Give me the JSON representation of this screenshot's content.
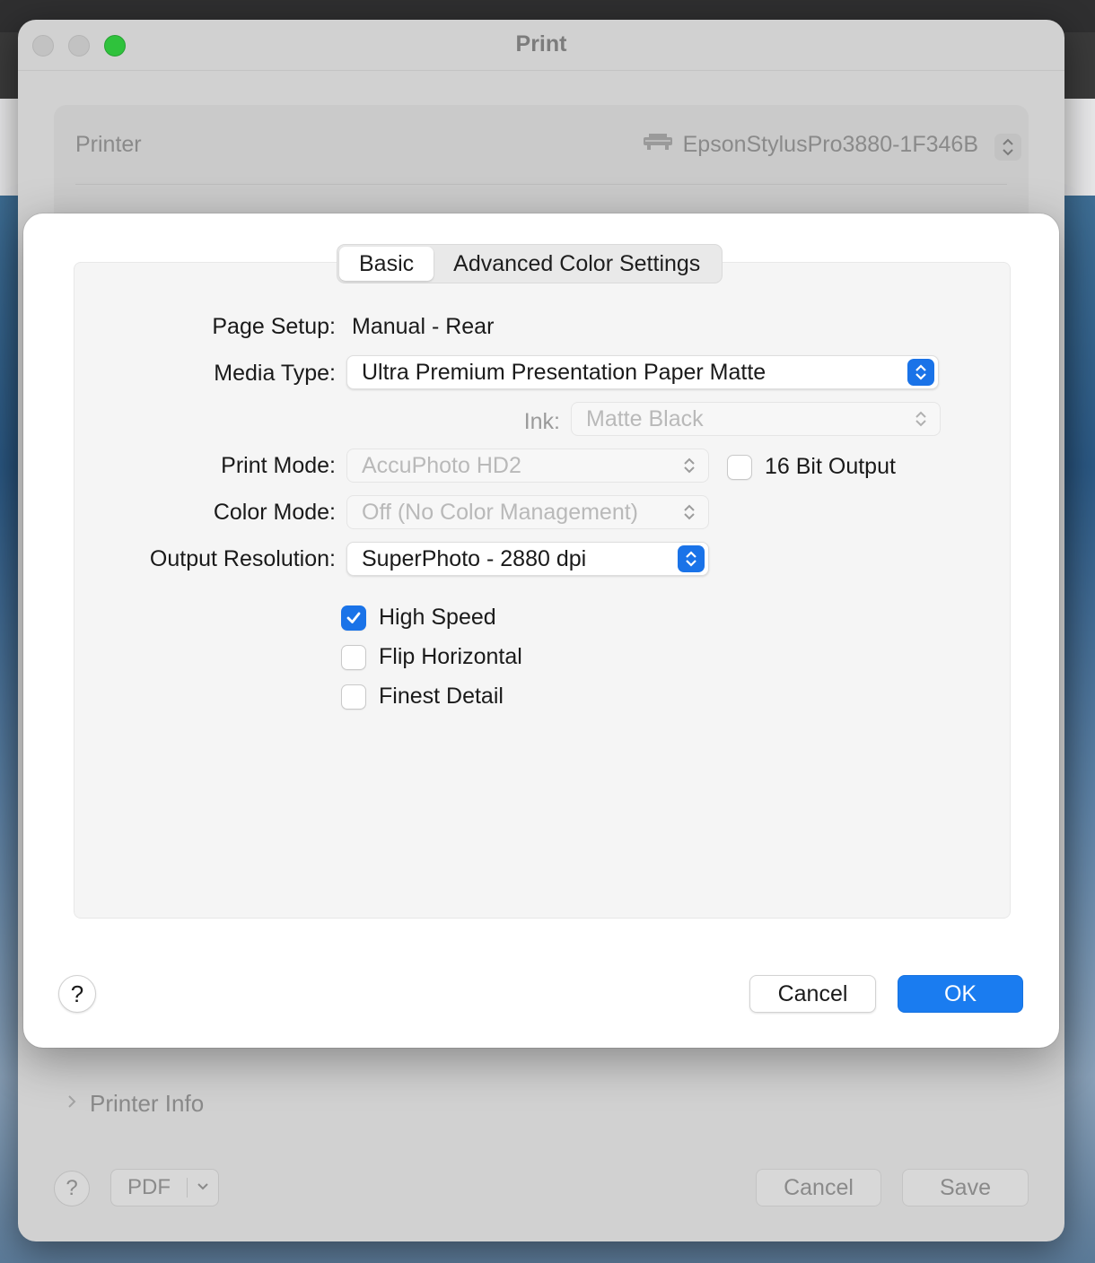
{
  "window": {
    "title": "Print",
    "printer_label": "Printer",
    "printer_value": "EpsonStylusPro3880-1F346B",
    "printer_info_label": "Printer Info",
    "bottom": {
      "help": "?",
      "pdf_label": "PDF",
      "cancel_label": "Cancel",
      "save_label": "Save"
    }
  },
  "sheet": {
    "tabs": [
      {
        "label": "Basic",
        "active": true
      },
      {
        "label": "Advanced Color Settings",
        "active": false
      }
    ],
    "page_setup": {
      "label": "Page Setup:",
      "value": "Manual - Rear"
    },
    "media_type": {
      "label": "Media Type:",
      "value": "Ultra Premium Presentation Paper Matte"
    },
    "ink": {
      "label": "Ink:",
      "value": "Matte Black"
    },
    "print_mode": {
      "label": "Print Mode:",
      "value": "AccuPhoto HD2"
    },
    "sixteen_bit": {
      "label": "16 Bit Output",
      "checked": false
    },
    "color_mode": {
      "label": "Color Mode:",
      "value": "Off (No Color Management)"
    },
    "output_resolution": {
      "label": "Output Resolution:",
      "value": "SuperPhoto - 2880 dpi"
    },
    "checkboxes": [
      {
        "label": "High Speed",
        "checked": true
      },
      {
        "label": "Flip Horizontal",
        "checked": false
      },
      {
        "label": "Finest Detail",
        "checked": false
      }
    ],
    "help": "?",
    "cancel_label": "Cancel",
    "ok_label": "OK"
  },
  "colors": {
    "accent": "#1a7cf0",
    "traffic_zoom": "#2fc23c"
  }
}
